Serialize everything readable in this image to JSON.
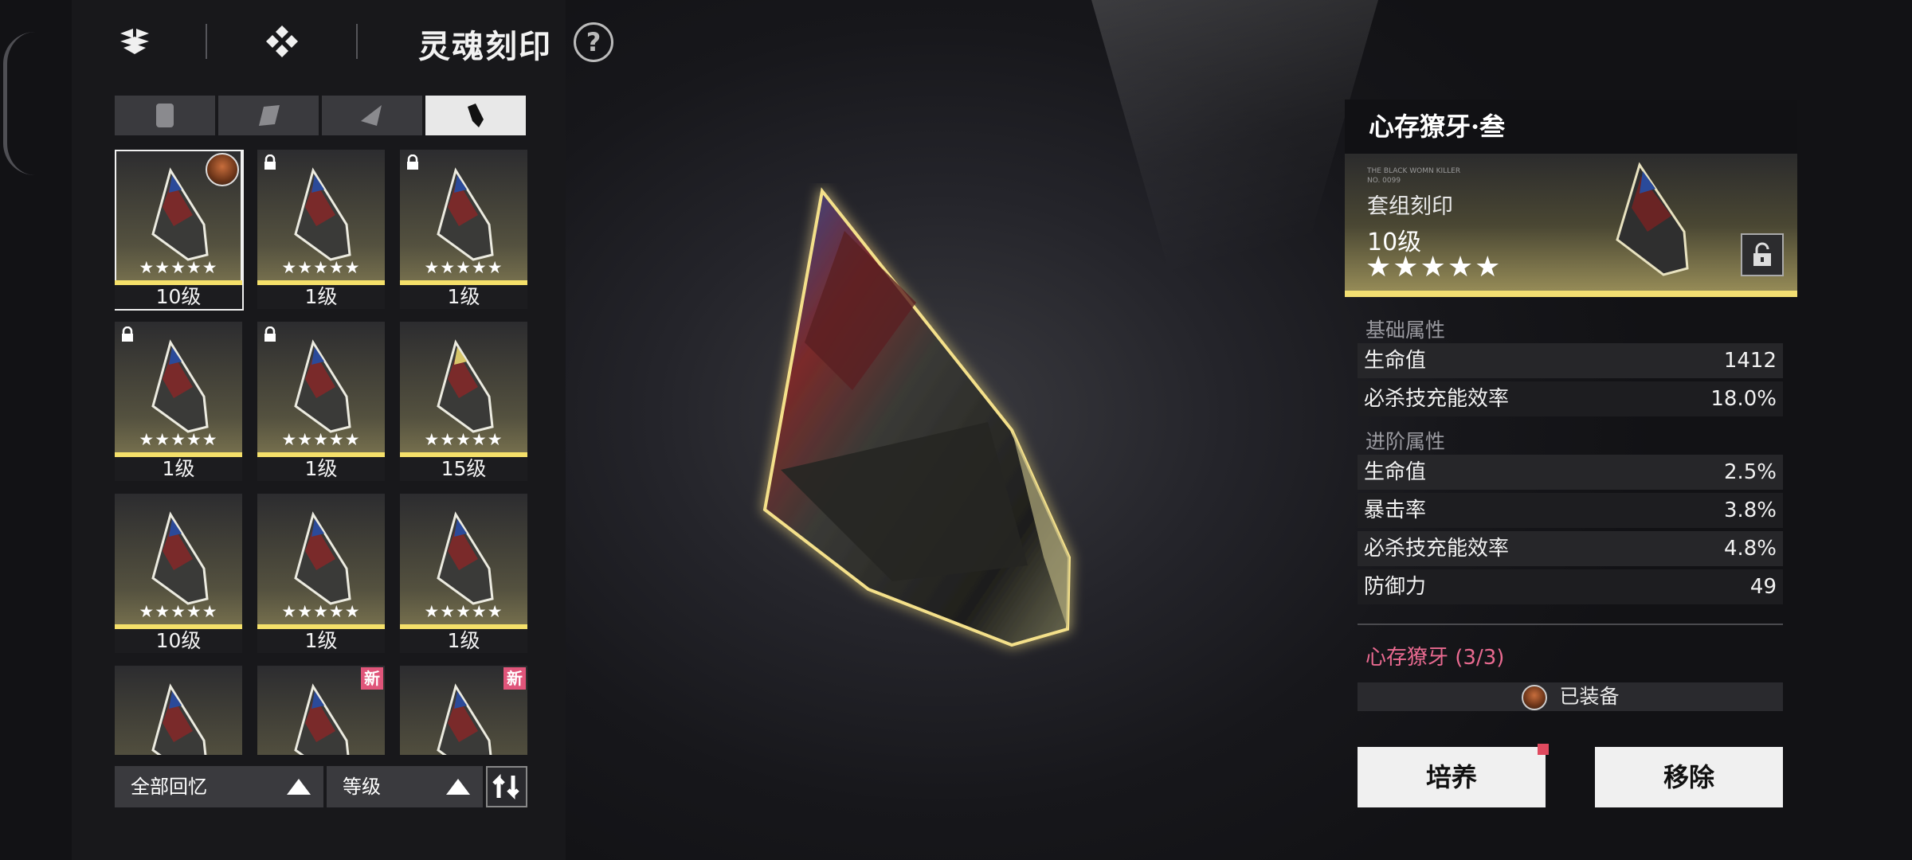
{
  "header": {
    "title": "灵魂刻印",
    "help_label": "?"
  },
  "slot_tabs": [
    {
      "icon": "slot-1-icon",
      "active": false
    },
    {
      "icon": "slot-2-icon",
      "active": false
    },
    {
      "icon": "slot-3-icon",
      "active": false
    },
    {
      "icon": "slot-4-icon",
      "active": true
    }
  ],
  "cards": [
    {
      "level": "10级",
      "stars": "★★★★★",
      "badge": "avatar",
      "selected": true
    },
    {
      "level": "1级",
      "stars": "★★★★★",
      "badge": "lock"
    },
    {
      "level": "1级",
      "stars": "★★★★★",
      "badge": "lock"
    },
    {
      "level": "1级",
      "stars": "★★★★★",
      "badge": "lock"
    },
    {
      "level": "1级",
      "stars": "★★★★★",
      "badge": "lock"
    },
    {
      "level": "15级",
      "stars": "★★★★★",
      "badge": ""
    },
    {
      "level": "10级",
      "stars": "★★★★★",
      "badge": ""
    },
    {
      "level": "1级",
      "stars": "★★★★★",
      "badge": ""
    },
    {
      "level": "1级",
      "stars": "★★★★★",
      "badge": ""
    },
    {
      "level": "",
      "stars": "",
      "badge": ""
    },
    {
      "level": "",
      "stars": "",
      "badge": "new",
      "new_label": "新"
    },
    {
      "level": "",
      "stars": "",
      "badge": "new",
      "new_label": "新"
    }
  ],
  "filters": {
    "memory_label": "全部回忆",
    "sort_label": "等级"
  },
  "detail": {
    "name": "心存獠牙·叁",
    "caption_line1": "THE BLACK WOMN KILLER",
    "caption_line2": "NO. 0099",
    "type": "套组刻印",
    "level": "10级",
    "stars": "★★★★★",
    "base_label": "基础属性",
    "base_stats": [
      {
        "name": "生命值",
        "value": "1412"
      },
      {
        "name": "必杀技充能效率",
        "value": "18.0%"
      }
    ],
    "adv_label": "进阶属性",
    "adv_stats": [
      {
        "name": "生命值",
        "value": "2.5%"
      },
      {
        "name": "暴击率",
        "value": "3.8%"
      },
      {
        "name": "必杀技充能效率",
        "value": "4.8%"
      },
      {
        "name": "防御力",
        "value": "49"
      }
    ],
    "set_name": "心存獠牙 (3/3)",
    "equipped_label": "已装备",
    "train_label": "培养",
    "remove_label": "移除"
  },
  "colors": {
    "accent_yellow": "#f2de72",
    "set_pink": "#e96a90",
    "new_badge": "#e0557a"
  }
}
